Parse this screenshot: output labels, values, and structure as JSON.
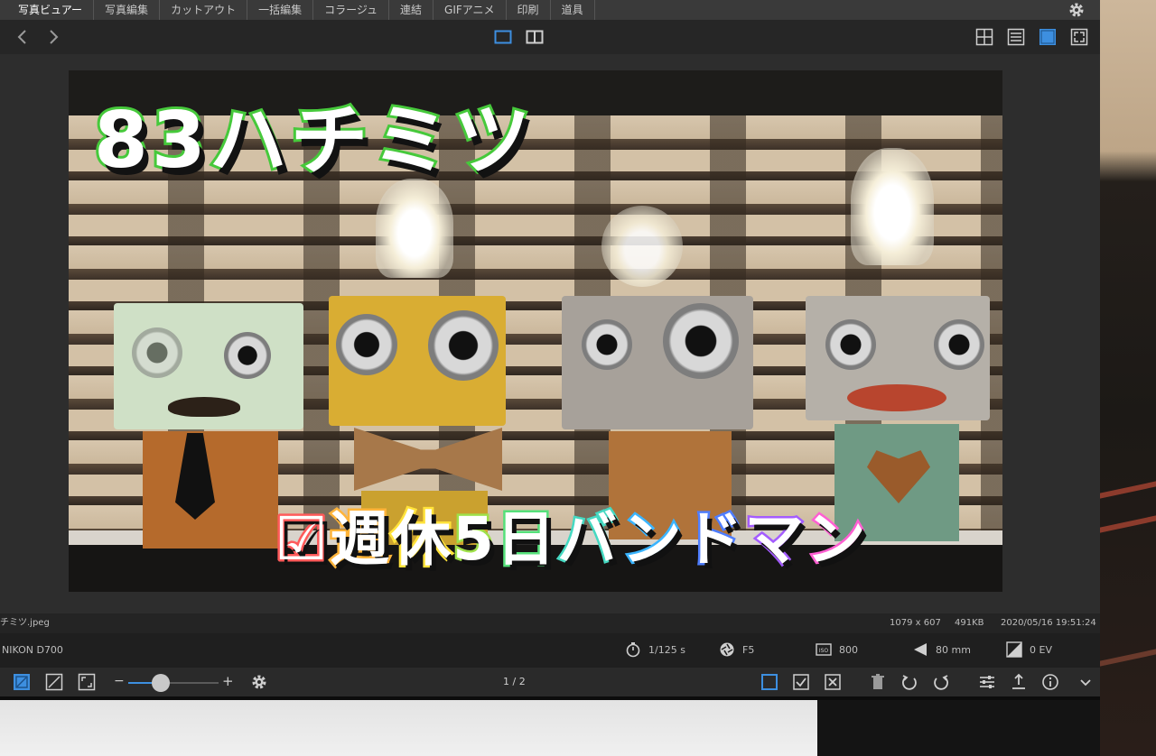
{
  "menu": {
    "items": [
      "写真ビュアー",
      "写真編集",
      "カットアウト",
      "一括編集",
      "コラージュ",
      "連結",
      "GIFアニメ",
      "印刷",
      "道具"
    ]
  },
  "icons": {
    "settings": "gear-icon",
    "back": "chevron-left-icon",
    "forward": "chevron-right-icon",
    "single_view": "single-view-icon",
    "compare_view": "split-view-icon",
    "grid_view": "grid-view-icon",
    "list_view": "list-view-icon",
    "detail_view": "detail-view-icon",
    "fullscreen": "fullscreen-icon"
  },
  "photo": {
    "title_main": "83ハチミツ",
    "subtitle_chars": [
      {
        "text": "☑",
        "color": "#ff5a5a"
      },
      {
        "text": "週",
        "color": "#ffb43a"
      },
      {
        "text": "休",
        "color": "#ffe23a"
      },
      {
        "text": "5",
        "color": "#9ee04a"
      },
      {
        "text": "日",
        "color": "#55e07a"
      },
      {
        "text": "バ",
        "color": "#45d9c2"
      },
      {
        "text": "ン",
        "color": "#3ab4ff"
      },
      {
        "text": "ド",
        "color": "#4e7dff"
      },
      {
        "text": "マ",
        "color": "#a45cff"
      },
      {
        "text": "ン",
        "color": "#ff5fd2"
      }
    ]
  },
  "file": {
    "name": "チミツ.jpeg",
    "dimensions": "1079 x 607",
    "size": "491KB",
    "date": "2020/05/16 19:51:24"
  },
  "exif": {
    "camera": "NIKON D700",
    "shutter": "1/125 s",
    "aperture": "F5",
    "iso": "800",
    "focal": "80 mm",
    "exposure": "0 EV"
  },
  "pager": "1 / 2",
  "zoom": {
    "minus": "−",
    "plus": "+",
    "level": 0.36
  },
  "colors": {
    "accent": "#3d8fe0",
    "title_stroke": "#46c93b"
  }
}
